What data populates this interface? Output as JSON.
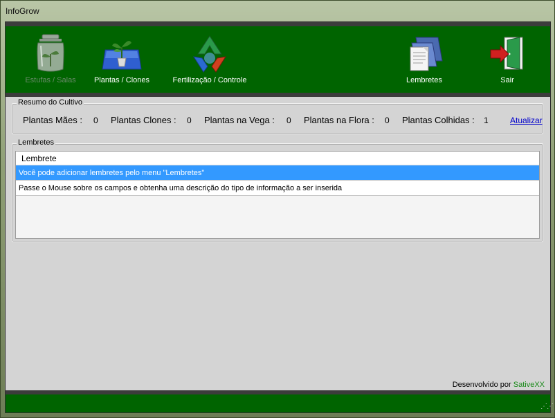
{
  "window": {
    "title": "InfoGrow"
  },
  "toolbar": {
    "items": [
      {
        "label": "Estufas / Salas",
        "icon": "jar-plant-icon",
        "enabled": false
      },
      {
        "label": "Plantas / Clones",
        "icon": "potted-plant-icon",
        "enabled": true
      },
      {
        "label": "Fertilização / Controle",
        "icon": "recycle-icon",
        "enabled": true
      },
      {
        "label": "Lembretes",
        "icon": "documents-icon",
        "enabled": true
      },
      {
        "label": "Sair",
        "icon": "exit-door-icon",
        "enabled": true
      }
    ]
  },
  "summary": {
    "title": "Resumo do Cultivo",
    "fields": [
      {
        "label": "Plantas Mães :",
        "value": "0"
      },
      {
        "label": "Plantas Clones :",
        "value": "0"
      },
      {
        "label": "Plantas na Vega :",
        "value": "0"
      },
      {
        "label": "Plantas na Flora :",
        "value": "0"
      },
      {
        "label": "Plantas Colhidas :",
        "value": "1"
      }
    ],
    "refresh_link": "Atualizar"
  },
  "reminders": {
    "title": "Lembretes",
    "column_header": "Lembrete",
    "rows": [
      "Você pode adicionar lembretes pelo menu \"Lembretes\"",
      "Passe o Mouse sobre os campos e obtenha uma descrição do tipo de informação a ser inserida"
    ]
  },
  "footer": {
    "prefix": "Desenvolvido por",
    "brand": "SativeXX"
  },
  "colors": {
    "toolbar_bg": "#006400",
    "selection": "#3399ff",
    "link": "#0000cc",
    "brand": "#1a8a1a"
  }
}
